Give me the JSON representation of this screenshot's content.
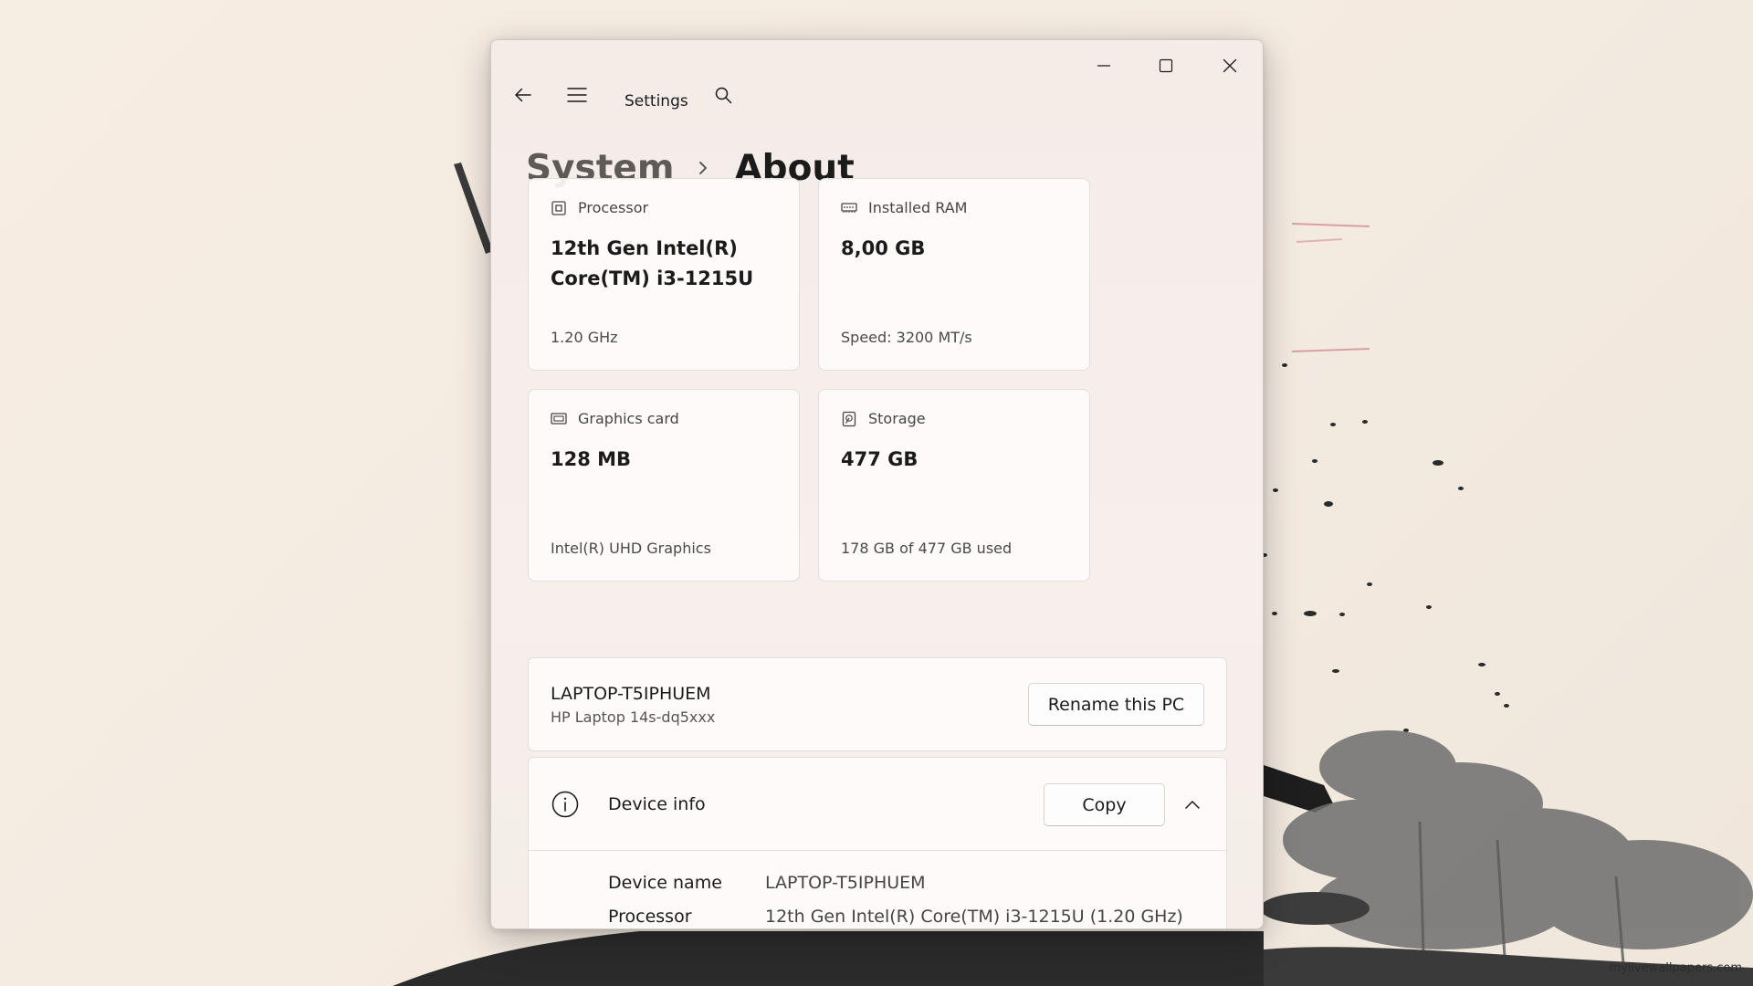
{
  "window": {
    "title": "Settings"
  },
  "breadcrumb": {
    "parent": "System",
    "current": "About"
  },
  "specs": [
    {
      "label": "Processor",
      "value": "12th Gen Intel(R) Core(TM) i3-1215U",
      "sub": "1.20 GHz",
      "icon": "processor-icon"
    },
    {
      "label": "Installed RAM",
      "value": "8,00 GB",
      "sub": "Speed: 3200 MT/s",
      "icon": "ram-icon"
    },
    {
      "label": "Graphics card",
      "value": "128 MB",
      "sub": "Intel(R) UHD Graphics",
      "icon": "graphics-card-icon"
    },
    {
      "label": "Storage",
      "value": "477 GB",
      "sub": "178 GB of 477 GB used",
      "icon": "storage-icon"
    }
  ],
  "pc": {
    "name": "LAPTOP-T5IPHUEM",
    "model": "HP Laptop 14s-dq5xxx",
    "rename_label": "Rename this PC"
  },
  "device_info": {
    "title": "Device info",
    "copy_label": "Copy",
    "rows": [
      {
        "label": "Device name",
        "value": "LAPTOP-T5IPHUEM"
      },
      {
        "label": "Processor",
        "value": "12th Gen Intel(R) Core(TM) i3-1215U (1.20 GHz)"
      }
    ]
  },
  "wallpaper": {
    "watermark": "mylivewallpapers.com"
  },
  "colors": {
    "accent_text": "#1b1b1b",
    "window_bg": "#f5ece8",
    "card_bg": "#fdfbfa"
  }
}
